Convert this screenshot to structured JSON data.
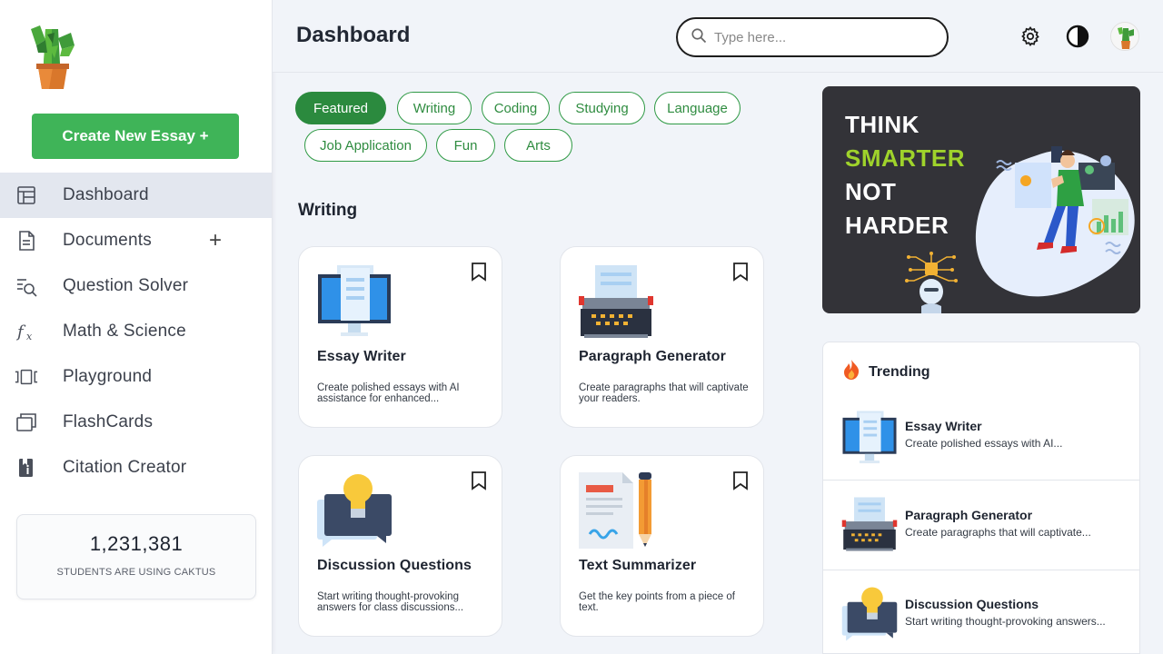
{
  "sidebar": {
    "create_button": "Create New Essay +",
    "items": [
      {
        "label": "Dashboard",
        "icon": "dashboard-icon",
        "active": true
      },
      {
        "label": "Documents",
        "icon": "document-icon",
        "plus": "+"
      },
      {
        "label": "Question Solver",
        "icon": "search-list-icon"
      },
      {
        "label": "Math & Science",
        "icon": "function-icon"
      },
      {
        "label": "Playground",
        "icon": "carousel-icon"
      },
      {
        "label": "FlashCards",
        "icon": "cards-icon"
      },
      {
        "label": "Citation Creator",
        "icon": "book-icon"
      }
    ],
    "stats": {
      "count": "1,231,381",
      "caption": "STUDENTS ARE USING CAKTUS"
    }
  },
  "header": {
    "title": "Dashboard",
    "search_placeholder": "Type here..."
  },
  "chips": [
    "Featured",
    "Writing",
    "Coding",
    "Studying",
    "Language",
    "Job Application",
    "Fun",
    "Arts"
  ],
  "active_chip": "Featured",
  "section": {
    "title": "Writing"
  },
  "cards": [
    {
      "title": "Essay Writer",
      "desc": "Create polished essays with AI assistance for enhanced...",
      "icon": "monitor-icon"
    },
    {
      "title": "Paragraph Generator",
      "desc": "Create paragraphs that will captivate your readers.",
      "icon": "typewriter-icon"
    },
    {
      "title": "Discussion Questions",
      "desc": "Start writing thought-provoking answers for class discussions...",
      "icon": "lightbulb-icon"
    },
    {
      "title": "Text Summarizer",
      "desc": "Get the key points from a piece of text.",
      "icon": "document-pencil-icon"
    }
  ],
  "banner": {
    "lines": [
      "THINK",
      "SMARTER",
      "NOT",
      "HARDER"
    ]
  },
  "trending": {
    "title": "Trending",
    "items": [
      {
        "name": "Essay Writer",
        "desc": "Create polished essays with AI..."
      },
      {
        "name": "Paragraph Generator",
        "desc": "Create paragraphs that will captivate..."
      },
      {
        "name": "Discussion Questions",
        "desc": "Start writing thought-provoking answers..."
      }
    ]
  },
  "colors": {
    "brand_green": "#3fb458",
    "chip_green": "#2b8a3e",
    "banner_bg": "#333338",
    "accent_lime": "#9fd32b"
  }
}
